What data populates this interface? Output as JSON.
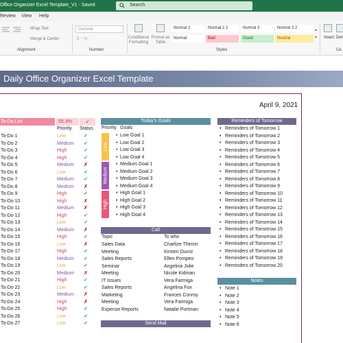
{
  "window": {
    "title": "Office Organizer Excel Template_V1  -  Saved",
    "search_placeholder": "Search"
  },
  "menu": [
    "Review",
    "View",
    "Help"
  ],
  "ribbon": {
    "wrap_text": "Wrap Text",
    "merge_center": "Merge & Center",
    "alignment_group": "Alignment",
    "number_format": "General",
    "number_group": "Number",
    "conditional_formatting": "Conditional Formatting",
    "format_as_table": "Format as Table",
    "styles": [
      "Normal 2",
      "Normal 2 2",
      "Normal 3",
      "Normal 3 2",
      "Normal",
      "Bad",
      "Good",
      "Neutral"
    ],
    "styles_group": "Styles",
    "insert": "Insert",
    "delete": "Del",
    "cells_group": "Ce"
  },
  "sheet": {
    "banner_title": "Daily Office Organizer Excel Template",
    "date": "April 9, 2021",
    "todo": {
      "title": "To-Do List",
      "percent": "55.3%",
      "check_mark": "✓",
      "col_priority": "Priority",
      "col_status": "Status",
      "rows": [
        {
          "task": "To-Do 1",
          "priority": "Low",
          "status": "done"
        },
        {
          "task": "To-Do 2",
          "priority": "Medium",
          "status": "done"
        },
        {
          "task": "To-Do 3",
          "priority": "High",
          "status": "done"
        },
        {
          "task": "To-Do 4",
          "priority": "High",
          "status": "done"
        },
        {
          "task": "To-Do 5",
          "priority": "Medium",
          "status": "not"
        },
        {
          "task": "To-Do 6",
          "priority": "Low",
          "status": "done"
        },
        {
          "task": "To-Do 7",
          "priority": "Medium",
          "status": "done"
        },
        {
          "task": "To-Do 8",
          "priority": "Medium",
          "status": "not"
        },
        {
          "task": "To-Do 9",
          "priority": "High",
          "status": "done"
        },
        {
          "task": "To-Do 10",
          "priority": "High",
          "status": "not"
        },
        {
          "task": "To-Do 11",
          "priority": "Medium",
          "status": "not"
        },
        {
          "task": "To-Do 12",
          "priority": "High",
          "status": "done"
        },
        {
          "task": "To-Do 13",
          "priority": "Low",
          "status": "done"
        },
        {
          "task": "To-Do 14",
          "priority": "Medium",
          "status": "not"
        },
        {
          "task": "To-Do 15",
          "priority": "High",
          "status": "done"
        },
        {
          "task": "To-Do 16",
          "priority": "Low",
          "status": "not"
        },
        {
          "task": "To-Do 17",
          "priority": "High",
          "status": "done"
        },
        {
          "task": "To-Do 18",
          "priority": "Medium",
          "status": "done"
        },
        {
          "task": "To-Do 19",
          "priority": "Low",
          "status": "done"
        },
        {
          "task": "To-Do 20",
          "priority": "Medium",
          "status": "not"
        },
        {
          "task": "To-Do 21",
          "priority": "High",
          "status": "done"
        },
        {
          "task": "To-Do 22",
          "priority": "Low",
          "status": "done"
        },
        {
          "task": "To-Do 23",
          "priority": "Medium",
          "status": "not"
        },
        {
          "task": "To-Do 24",
          "priority": "High",
          "status": "not"
        },
        {
          "task": "To-Do 25",
          "priority": "High",
          "status": "done"
        },
        {
          "task": "To-Do 26",
          "priority": "Low",
          "status": "done"
        },
        {
          "task": "To-Do 27",
          "priority": "Low",
          "status": "done"
        }
      ]
    },
    "goals": {
      "title": "Today's Goals",
      "col_priority": "Priority",
      "col_goals": "Goals",
      "groups": [
        {
          "label": "Low",
          "color": "#f6c34a",
          "items": [
            "Low Goal 1",
            "Low Goal 2",
            "Low Goal 3",
            "Low Goal 4"
          ]
        },
        {
          "label": "Medium",
          "color": "#9b59b6",
          "items": [
            "Medium Goal 1",
            "Medium Goal 2",
            "Medium Goal 3",
            "Medium Goal 4"
          ]
        },
        {
          "label": "High",
          "color": "#e8587a",
          "items": [
            "High Goal 1",
            "High Goal 2",
            "High Goal 3",
            "High Goal 4"
          ]
        }
      ]
    },
    "call": {
      "title": "Call",
      "col_topic": "Topic",
      "col_to": "To who",
      "rows": [
        {
          "topic": "Sales Data",
          "to": "Charlize Theron"
        },
        {
          "topic": "Meeting",
          "to": "Kirsten Dunst"
        },
        {
          "topic": "Sales Reports",
          "to": "Ellen Pompeo"
        },
        {
          "topic": "Seminar",
          "to": "Angelina Jolie"
        },
        {
          "topic": "Meeting",
          "to": "Nicole Kidman"
        },
        {
          "topic": "IT Issues",
          "to": "Vera Farmiga"
        },
        {
          "topic": "Sales Reports",
          "to": "Angelina Fox"
        },
        {
          "topic": "Marketing",
          "to": "Frances Conroy"
        },
        {
          "topic": "Meeting",
          "to": "Vera Farmiga"
        },
        {
          "topic": "Expense Reports",
          "to": "Natalie Portman"
        }
      ]
    },
    "send_mail": {
      "title": "Send Mail"
    },
    "reminders": {
      "title": "Reminders of Tomorrow",
      "items": [
        "Reminders of Tomorrow 1",
        "Reminders of Tomorrow 2",
        "Reminders of Tomorrow 3",
        "Reminders of Tomorrow 4",
        "Reminders of Tomorrow 5",
        "Reminders of Tomorrow 6",
        "Reminders of Tomorrow 7",
        "Reminders of Tomorrow 8",
        "Reminders of Tomorrow 9",
        "Reminders of Tomorrow 10",
        "Reminders of Tomorrow 11",
        "Reminders of Tomorrow 12",
        "Reminders of Tomorrow 13",
        "Reminders of Tomorrow 14",
        "Reminders of Tomorrow 15",
        "Reminders of Tomorrow 16",
        "Reminders of Tomorrow 17",
        "Reminders of Tomorrow 18",
        "Reminders of Tomorrow 19",
        "Reminders of Tomorrow 20"
      ]
    },
    "notes": {
      "title": "Notes",
      "items": [
        "Note 1",
        "Note 2",
        "Note 3",
        "Note 4",
        "Note 5",
        "Note 6"
      ]
    },
    "bullet_char": "•",
    "cross_mark": "✗",
    "colors": {
      "todo_header": "#f08aa0",
      "goals_header": "#5b8fa0",
      "call_header": "#6e6a8f",
      "mail_header": "#6e6a8f",
      "reminders_header": "#6e6a8f",
      "notes_header": "#5b8fa0",
      "title_bar": "#217346",
      "frame": "#7a2755"
    }
  }
}
